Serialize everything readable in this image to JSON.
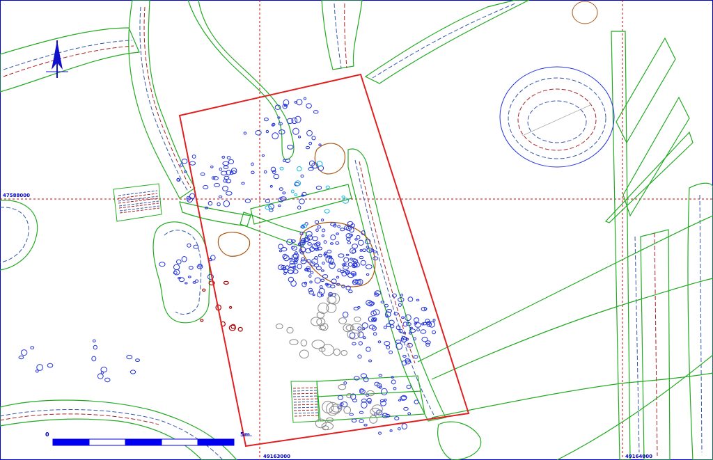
{
  "map": {
    "grid_labels": {
      "northing_left": "47588000",
      "easting_center": "49163000",
      "easting_right": "49164000"
    },
    "scale_bar": {
      "start_label": "0",
      "end_label": "5m."
    },
    "colors": {
      "background": "#ffffff",
      "frame": "#0000cc",
      "grid": "#cc0000",
      "excavation_boundary": "#e02020",
      "features": "#22aa22",
      "stones": "#2233dd",
      "north_arrow": "#1111cc"
    },
    "icons": [
      "north-arrow-icon",
      "scale-bar-icon"
    ]
  }
}
